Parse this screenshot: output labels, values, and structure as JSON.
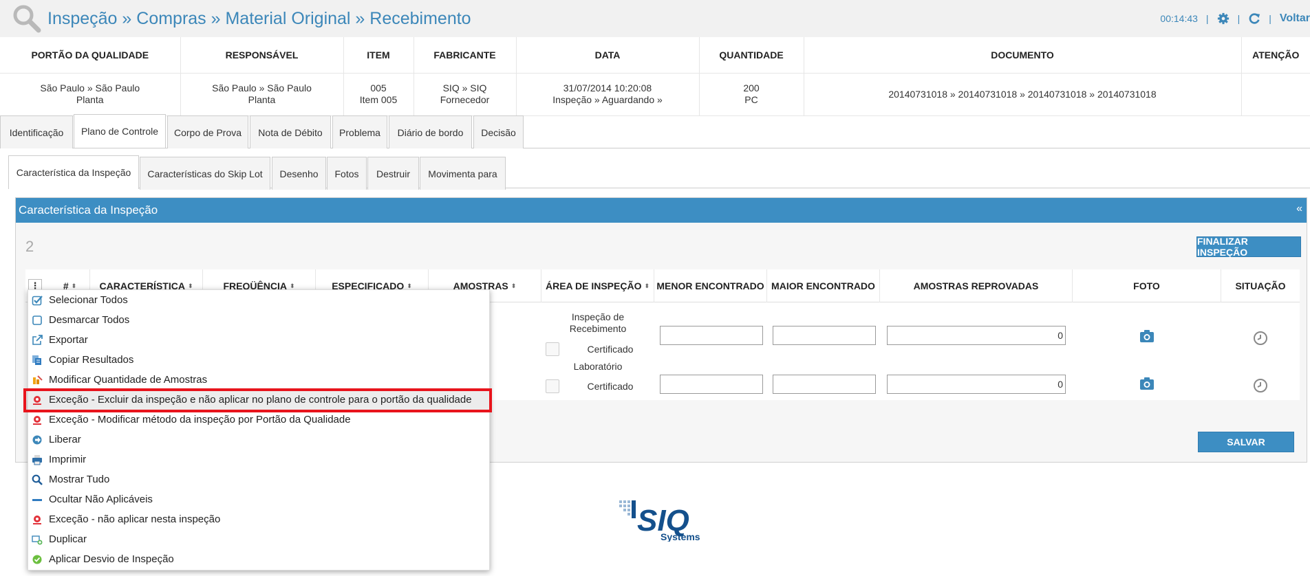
{
  "header": {
    "title": "Inspeção » Compras » Material Original » Recebimento",
    "time": "00:14:43",
    "separator": "|",
    "back_label": "Voltar"
  },
  "info_table": {
    "headers": [
      "PORTÃO DA QUALIDADE",
      "RESPONSÁVEL",
      "ITEM",
      "FABRICANTE",
      "DATA",
      "QUANTIDADE",
      "DOCUMENTO",
      "ATENÇÃO"
    ],
    "row": [
      [
        "São Paulo » São Paulo",
        "Planta"
      ],
      [
        "São Paulo » São Paulo",
        "Planta"
      ],
      [
        "005",
        "Item 005"
      ],
      [
        "SIQ » SIQ",
        "Fornecedor"
      ],
      [
        "31/07/2014 10:20:08",
        "Inspeção » Aguardando »"
      ],
      [
        "200",
        "PC"
      ],
      [
        "20140731018 » 20140731018 » 20140731018 » 20140731018",
        ""
      ],
      [
        "",
        ""
      ]
    ]
  },
  "tabs_main": [
    "Identificação",
    "Plano de Controle",
    "Corpo de Prova",
    "Nota de Débito",
    "Problema",
    "Diário de bordo",
    "Decisão"
  ],
  "tabs_sub": [
    "Característica da Inspeção",
    "Características do Skip Lot",
    "Desenho",
    "Fotos",
    "Destruir",
    "Movimenta para"
  ],
  "panel": {
    "title": "Característica da Inspeção",
    "collapse": "«",
    "count": "2",
    "finalize_label": "FINALIZAR INSPEÇÃO",
    "save_label": "SALVAR"
  },
  "grid": {
    "kebab": "⋮",
    "columns": {
      "num": "#",
      "caracteristica": "CARACTERÍSTICA",
      "frequencia": "FREQÜÊNCIA",
      "especificado": "ESPECIFICADO",
      "amostras": "AMOSTRAS",
      "area": "ÁREA DE INSPEÇÃO",
      "menor": "MENOR ENCONTRADO",
      "maior": "MAIOR ENCONTRADO",
      "reprovadas": "AMOSTRAS REPROVADAS",
      "foto": "FOTO",
      "situacao": "SITUAÇÃO"
    },
    "rows": [
      {
        "area": "Inspeção de Recebimento",
        "certificado": "Certificado",
        "reprovadas": "0"
      },
      {
        "area": "Laboratório",
        "certificado": "Certificado",
        "reprovadas": "0"
      }
    ]
  },
  "context_menu": {
    "items": [
      {
        "label": "Selecionar Todos",
        "icon": "checkbox-checked-icon"
      },
      {
        "label": "Desmarcar Todos",
        "icon": "checkbox-empty-icon"
      },
      {
        "label": "Exportar",
        "icon": "external-link-icon"
      },
      {
        "label": "Copiar Resultados",
        "icon": "copy-icon"
      },
      {
        "label": "Modificar Quantidade de Amostras",
        "icon": "edit-samples-icon"
      },
      {
        "label": "Exceção - Excluir da inspeção e não aplicar no plano de controle para o portão da qualidade",
        "icon": "exception-icon"
      },
      {
        "label": "Exceção - Modificar método da inspeção por Portão da Qualidade",
        "icon": "exception-icon"
      },
      {
        "label": "Liberar",
        "icon": "release-arrow-icon"
      },
      {
        "label": "Imprimir",
        "icon": "printer-icon"
      },
      {
        "label": "Mostrar Tudo",
        "icon": "search-icon"
      },
      {
        "label": "Ocultar Não Aplicáveis",
        "icon": "minus-icon"
      },
      {
        "label": "Exceção - não aplicar nesta inspeção",
        "icon": "exception-icon"
      },
      {
        "label": "Duplicar",
        "icon": "duplicate-icon"
      },
      {
        "label": "Aplicar Desvio de Inspeção",
        "icon": "check-circle-icon"
      }
    ]
  },
  "footer": {
    "brand": "SIQ",
    "brand_sub": "Systems"
  },
  "colors": {
    "accent": "#3d8ec3",
    "highlight_border": "#e8141c"
  }
}
